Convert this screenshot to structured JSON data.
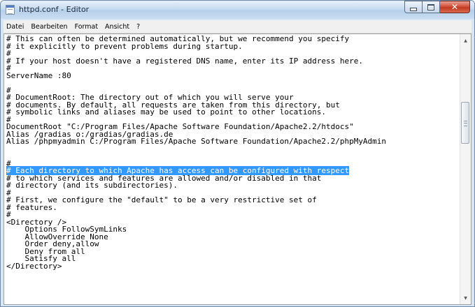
{
  "window": {
    "title": "httpd.conf - Editor"
  },
  "menu": [
    "Datei",
    "Bearbeiten",
    "Format",
    "Ansicht",
    "?"
  ],
  "editor": {
    "selected_line": 18,
    "lines": [
      "# This can often be determined automatically, but we recommend you specify",
      "# it explicitly to prevent problems during startup.",
      "#",
      "# If your host doesn't have a registered DNS name, enter its IP address here.",
      "#",
      "ServerName :80",
      "",
      "#",
      "# DocumentRoot: The directory out of which you will serve your",
      "# documents. By default, all requests are taken from this directory, but",
      "# symbolic links and aliases may be used to point to other locations.",
      "#",
      "DocumentRoot \"C:/Program Files/Apache Software Foundation/Apache2.2/htdocs\"",
      "Alias /gradias o:/gradias/gradias.de",
      "Alias /phpmyadmin C:/Program Files/Apache Software Foundation/Apache2.2/phpMyAdmin",
      "",
      "",
      "#",
      "# Each directory to which Apache has access can be configured with respect",
      "# to which services and features are allowed and/or disabled in that",
      "# directory (and its subdirectories).",
      "#",
      "# First, we configure the \"default\" to be a very restrictive set of",
      "# features.",
      "#",
      "<Directory />",
      "    Options FollowSymLinks",
      "    AllowOverride None",
      "    Order deny,allow",
      "    Deny from all",
      "    Satisfy all",
      "</Directory>"
    ]
  }
}
